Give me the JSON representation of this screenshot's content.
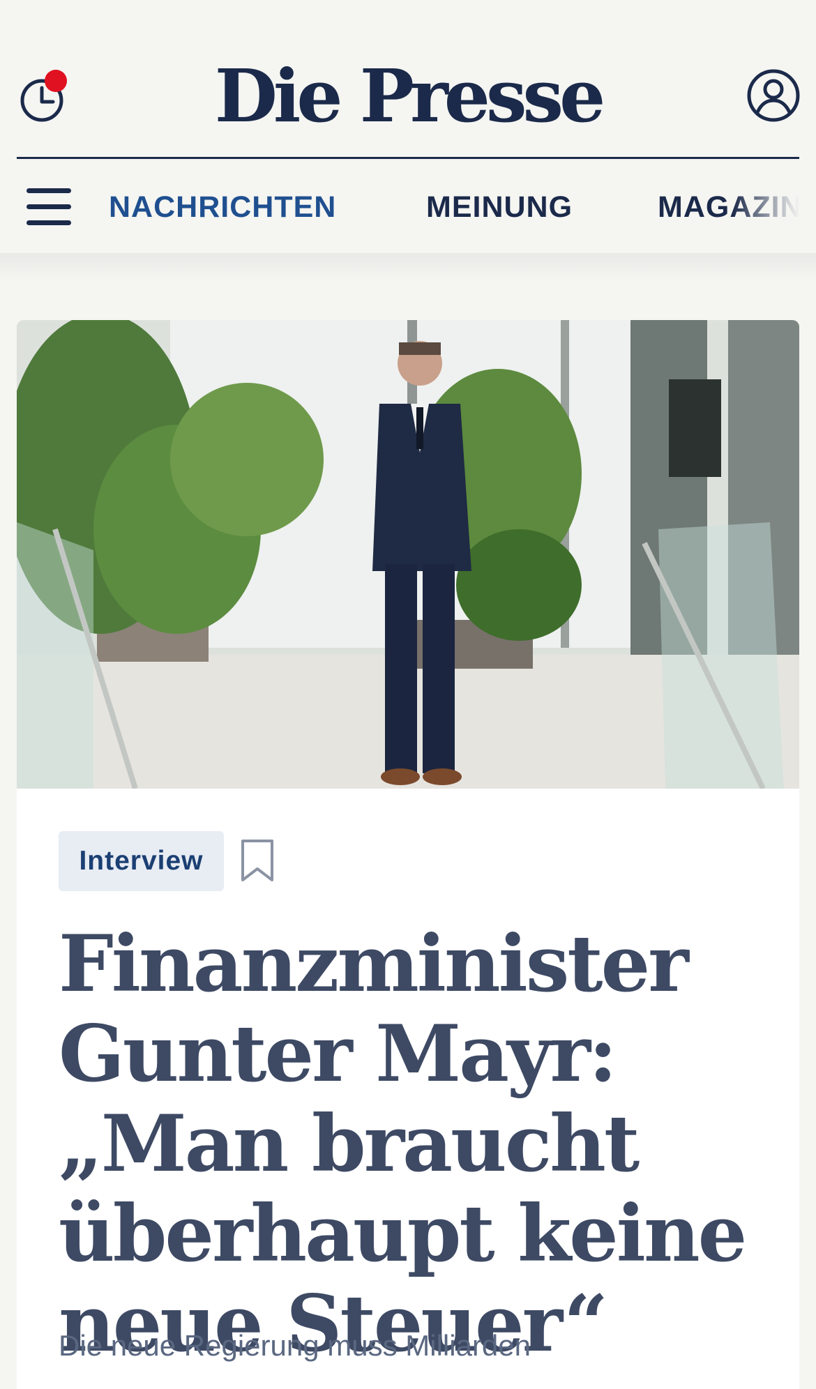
{
  "header": {
    "logo": "Die Presse",
    "history_icon": "history-clock-icon",
    "notification_dot_color": "#e01120",
    "account_icon": "account-circle-icon"
  },
  "nav": {
    "menu_icon": "hamburger-menu-icon",
    "items": [
      {
        "label": "NACHRICHTEN",
        "active": true
      },
      {
        "label": "MEINUNG",
        "active": false
      },
      {
        "label": "MAGAZIN",
        "active": false
      }
    ]
  },
  "article": {
    "image_description_icon": "hero-photo",
    "tag": "Interview",
    "bookmark_icon": "bookmark-icon",
    "headline": "Finanzminister Gunter Mayr: „Man braucht überhaupt keine neue Steuer“",
    "lead": "Die neue Regierung muss Milliarden"
  },
  "colors": {
    "brand_navy": "#1b2a4a",
    "nav_active": "#1f4f8f",
    "headline": "#3e4a64",
    "tag_bg": "#e8ecf3",
    "page_bg": "#f5f5f2"
  }
}
